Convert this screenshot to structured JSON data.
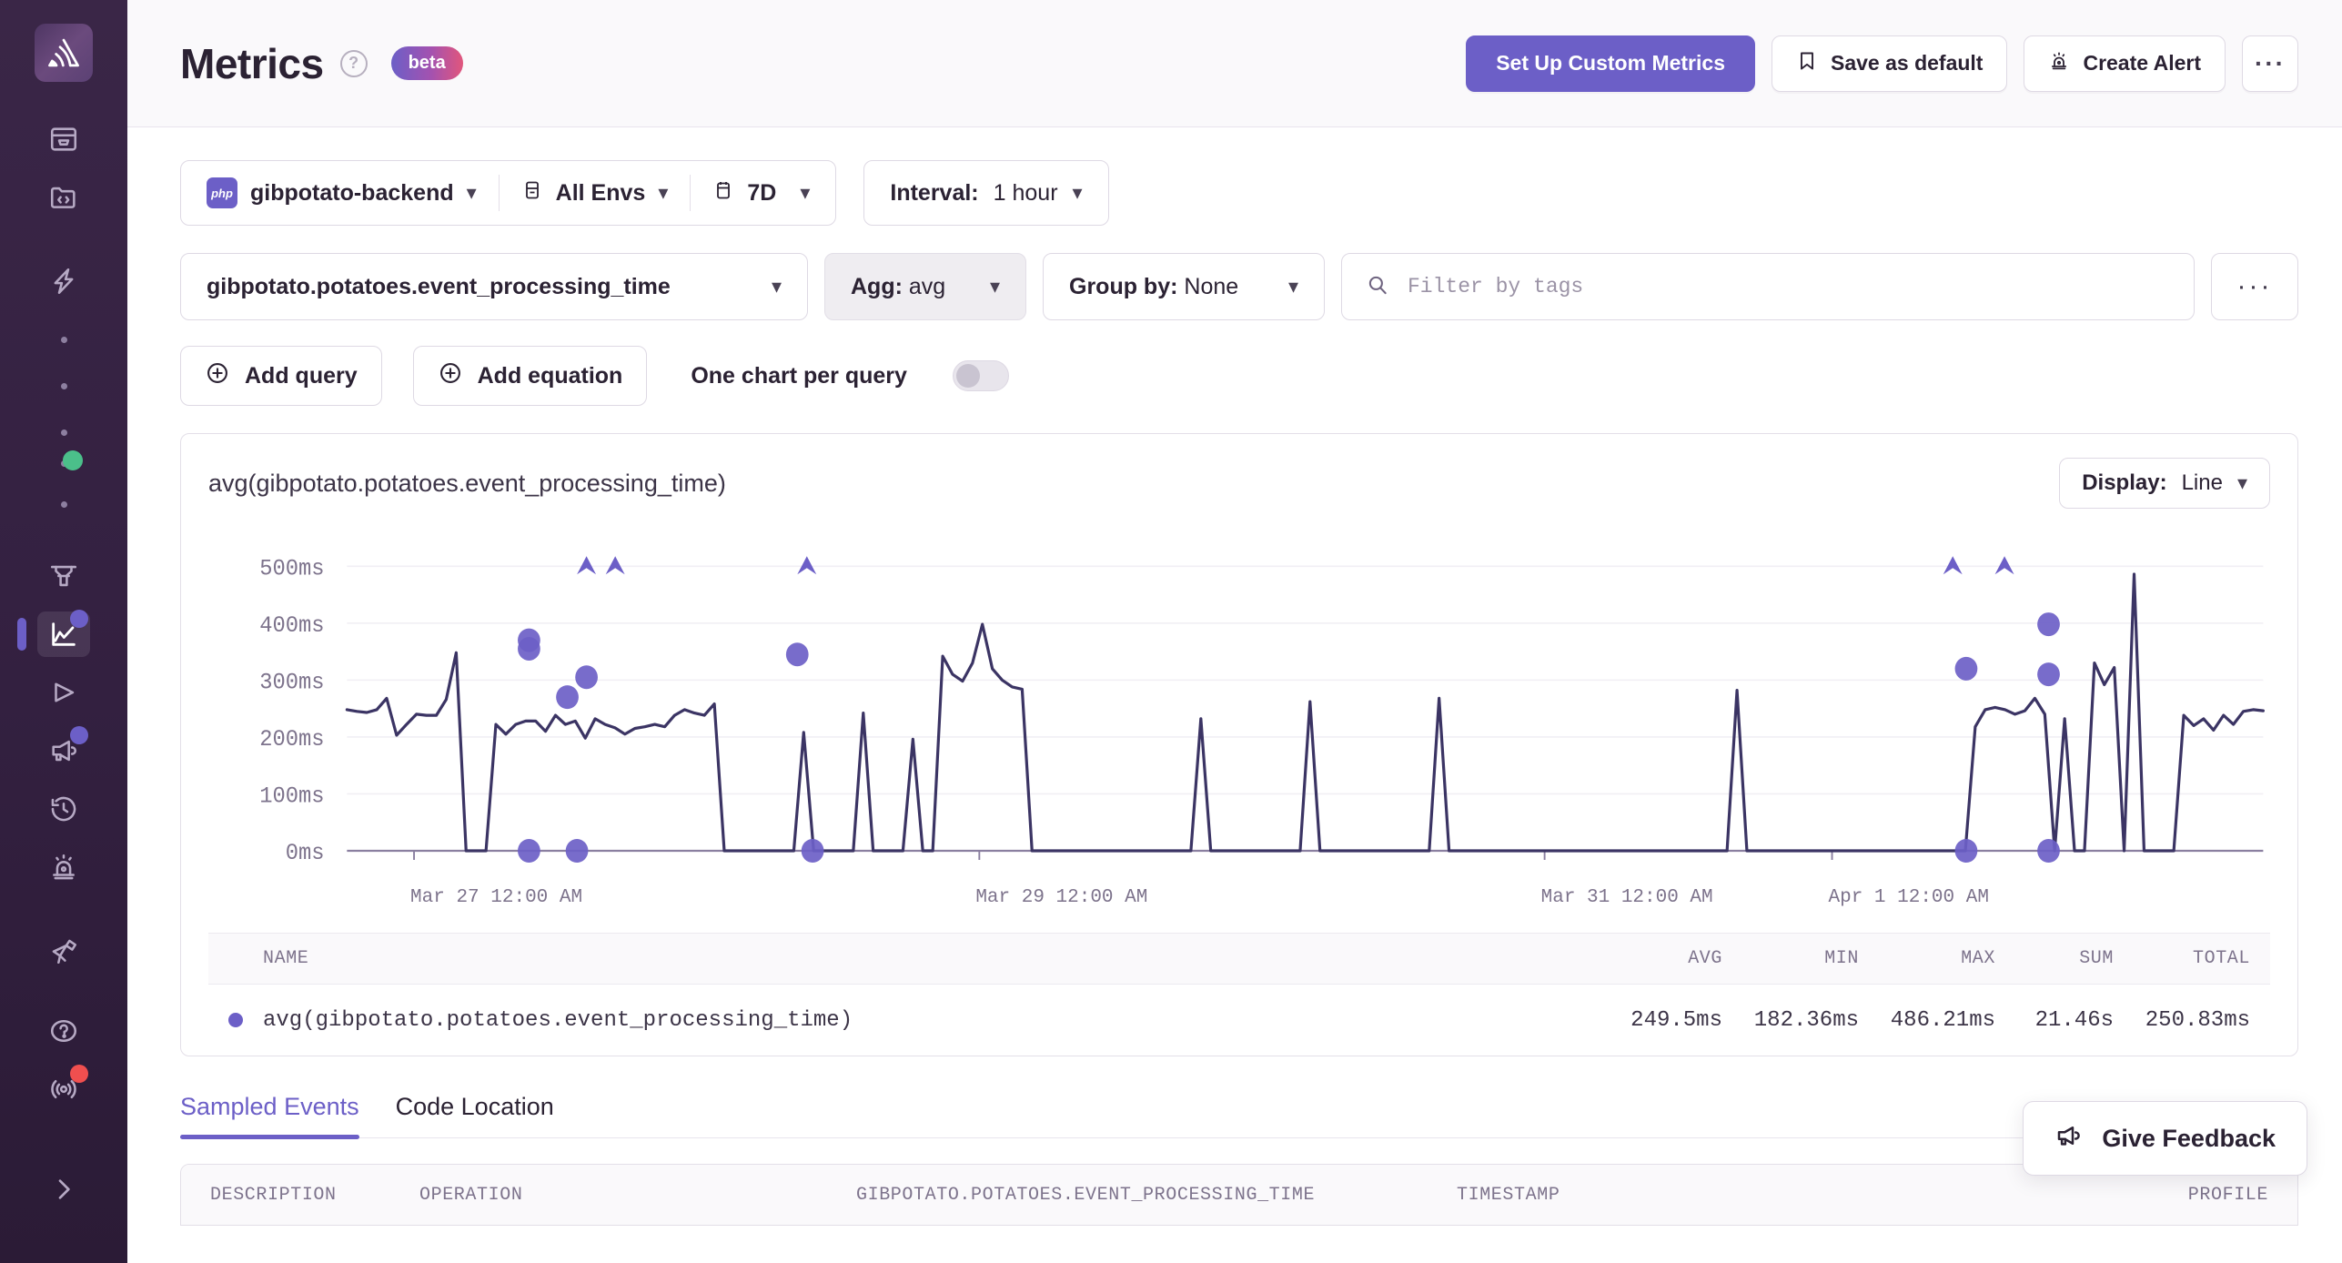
{
  "sidebar": {
    "logo": "sentry-logo",
    "items": [
      {
        "icon": "issues-icon",
        "badge": null
      },
      {
        "icon": "projects-code-folder-icon",
        "badge": null
      },
      {
        "icon": "performance-bolt-icon",
        "badge": null
      },
      {
        "icon": "dot",
        "badge": null
      },
      {
        "icon": "dot",
        "badge": null
      },
      {
        "icon": "dot",
        "badge": null
      },
      {
        "icon": "dot",
        "badge": "green"
      },
      {
        "icon": "dot",
        "badge": null
      },
      {
        "icon": "crons-icon",
        "badge": null
      },
      {
        "icon": "metrics-chart-icon",
        "badge": "purple",
        "active": true
      },
      {
        "icon": "replays-play-icon",
        "badge": null
      },
      {
        "icon": "feedback-megaphone-icon",
        "badge": "purple"
      },
      {
        "icon": "history-clock-icon",
        "badge": null
      },
      {
        "icon": "alerts-siren-icon",
        "badge": null
      },
      {
        "icon": "discover-telescope-icon",
        "badge": null
      },
      {
        "icon": "help-question-icon",
        "badge": null
      },
      {
        "icon": "broadcast-icon",
        "badge": "red"
      },
      {
        "icon": "expand-chevron-right-icon",
        "badge": null
      }
    ]
  },
  "header": {
    "title": "Metrics",
    "help_icon": "question-mark-icon",
    "badge": "beta",
    "actions": {
      "primary": "Set Up Custom Metrics",
      "save_as_default": "Save as default",
      "create_alert": "Create Alert",
      "more": "···"
    }
  },
  "filters": {
    "project": "gibpotato-backend",
    "project_platform": "php",
    "environment": "All Envs",
    "date_range": "7D",
    "interval_label": "Interval:",
    "interval_value": "1 hour"
  },
  "query": {
    "metric": "gibpotato.potatoes.event_processing_time",
    "agg_label": "Agg:",
    "agg_value": "avg",
    "groupby_label": "Group by:",
    "groupby_value": "None",
    "filter_placeholder": "Filter by tags",
    "more": "···"
  },
  "actions": {
    "add_query": "Add query",
    "add_equation": "Add equation",
    "one_chart_per_query": "One chart per query",
    "one_chart_per_query_on": false
  },
  "chart_panel": {
    "title": "avg(gibpotato.potatoes.event_processing_time)",
    "display_label": "Display:",
    "display_value": "Line"
  },
  "chart_data": {
    "type": "line",
    "title": "avg(gibpotato.potatoes.event_processing_time)",
    "xlabel": "",
    "ylabel": "",
    "ylim": [
      0,
      550
    ],
    "ytick_labels": [
      "0ms",
      "100ms",
      "200ms",
      "300ms",
      "400ms",
      "500ms"
    ],
    "ytick_values": [
      0,
      100,
      200,
      300,
      400,
      500
    ],
    "xtick_labels": [
      "Mar 27 12:00 AM",
      "Mar 29 12:00 AM",
      "Mar 31 12:00 AM",
      "Apr 1 12:00 AM"
    ],
    "xtick_positions": [
      0.035,
      0.33,
      0.625,
      0.775
    ],
    "grid": true,
    "legend_position": "below-table",
    "series": [
      {
        "name": "avg(gibpotato.potatoes.event_processing_time)",
        "color": "#3b3464",
        "values": [
          248,
          245,
          243,
          248,
          268,
          203,
          222,
          240,
          238,
          238,
          266,
          348,
          0,
          0,
          0,
          222,
          205,
          222,
          228,
          228,
          210,
          238,
          222,
          228,
          198,
          232,
          222,
          216,
          205,
          215,
          218,
          222,
          218,
          238,
          248,
          242,
          238,
          258,
          0,
          0,
          0,
          0,
          0,
          0,
          0,
          0,
          208,
          0,
          0,
          0,
          0,
          0,
          242,
          0,
          0,
          0,
          0,
          196,
          0,
          0,
          342,
          310,
          298,
          330,
          398,
          320,
          300,
          288,
          284,
          0,
          0,
          0,
          0,
          0,
          0,
          0,
          0,
          0,
          0,
          0,
          0,
          0,
          0,
          0,
          0,
          0,
          232,
          0,
          0,
          0,
          0,
          0,
          0,
          0,
          0,
          0,
          0,
          262,
          0,
          0,
          0,
          0,
          0,
          0,
          0,
          0,
          0,
          0,
          0,
          0,
          268,
          0,
          0,
          0,
          0,
          0,
          0,
          0,
          0,
          0,
          0,
          0,
          0,
          0,
          0,
          0,
          0,
          0,
          0,
          0,
          0,
          0,
          0,
          0,
          0,
          0,
          0,
          0,
          0,
          0,
          282,
          0,
          0,
          0,
          0,
          0,
          0,
          0,
          0,
          0,
          0,
          0,
          0,
          0,
          0,
          0,
          0,
          0,
          0,
          0,
          0,
          0,
          0,
          0,
          218,
          248,
          252,
          248,
          240,
          246,
          268,
          240,
          0,
          232,
          0,
          0,
          330,
          292,
          322,
          0,
          486,
          0,
          0,
          0,
          0,
          238,
          220,
          232,
          212,
          238,
          222,
          245,
          248,
          246
        ]
      }
    ],
    "sample_markers": {
      "color": "#6c5fc7",
      "circles": [
        {
          "x": 0.095,
          "y": 355
        },
        {
          "x": 0.095,
          "y": 370
        },
        {
          "x": 0.095,
          "y": 0
        },
        {
          "x": 0.125,
          "y": 305
        },
        {
          "x": 0.115,
          "y": 270
        },
        {
          "x": 0.12,
          "y": 0
        },
        {
          "x": 0.235,
          "y": 345
        },
        {
          "x": 0.243,
          "y": 0
        },
        {
          "x": 0.845,
          "y": 320
        },
        {
          "x": 0.845,
          "y": 0
        },
        {
          "x": 0.888,
          "y": 0
        },
        {
          "x": 0.888,
          "y": 398
        },
        {
          "x": 0.888,
          "y": 310
        }
      ],
      "triangles": [
        {
          "x": 0.125,
          "y": 500
        },
        {
          "x": 0.14,
          "y": 500
        },
        {
          "x": 0.24,
          "y": 500
        },
        {
          "x": 0.838,
          "y": 500
        },
        {
          "x": 0.865,
          "y": 500
        }
      ]
    }
  },
  "legend_table": {
    "columns": [
      "NAME",
      "AVG",
      "MIN",
      "MAX",
      "SUM",
      "TOTAL"
    ],
    "rows": [
      {
        "name": "avg(gibpotato.potatoes.event_processing_time)",
        "avg": "249.5ms",
        "min": "182.36ms",
        "max": "486.21ms",
        "sum": "21.46s",
        "total": "250.83ms"
      }
    ]
  },
  "tabs": [
    {
      "label": "Sampled Events",
      "active": true
    },
    {
      "label": "Code Location",
      "active": false
    }
  ],
  "events_table": {
    "columns": [
      "DESCRIPTION",
      "OPERATION",
      "GIBPOTATO.POTATOES.EVENT_PROCESSING_TIME",
      "TIMESTAMP",
      "PROFILE"
    ]
  },
  "feedback": {
    "label": "Give Feedback",
    "icon": "megaphone-icon"
  },
  "colors": {
    "accent": "#6c5fc7",
    "line": "#3b3464",
    "sidebar": "#332040",
    "text": "#2b2233",
    "muted": "#7d738c"
  }
}
